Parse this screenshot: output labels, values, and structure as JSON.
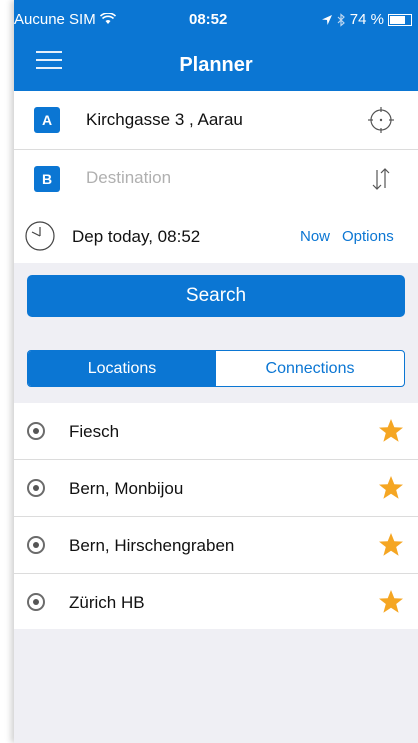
{
  "status": {
    "carrier": "Aucune SIM",
    "time": "08:52",
    "battery_percent": "74 %",
    "battery_level": 0.74
  },
  "nav": {
    "title": "Planner"
  },
  "from": {
    "badge": "A",
    "value": "Kirchgasse 3 , Aarau"
  },
  "to": {
    "badge": "B",
    "placeholder": "Destination"
  },
  "departure": {
    "text": "Dep today, 08:52",
    "now_label": "Now",
    "options_label": "Options"
  },
  "search_label": "Search",
  "tabs": [
    {
      "label": "Locations",
      "active": true
    },
    {
      "label": "Connections",
      "active": false
    }
  ],
  "locations": [
    {
      "label": "Fiesch"
    },
    {
      "label": "Bern, Monbijou"
    },
    {
      "label": "Bern, Hirschengraben"
    },
    {
      "label": "Zürich HB"
    }
  ],
  "colors": {
    "accent": "#0b76d3",
    "star": "#f5a623",
    "background": "#efeff4"
  }
}
